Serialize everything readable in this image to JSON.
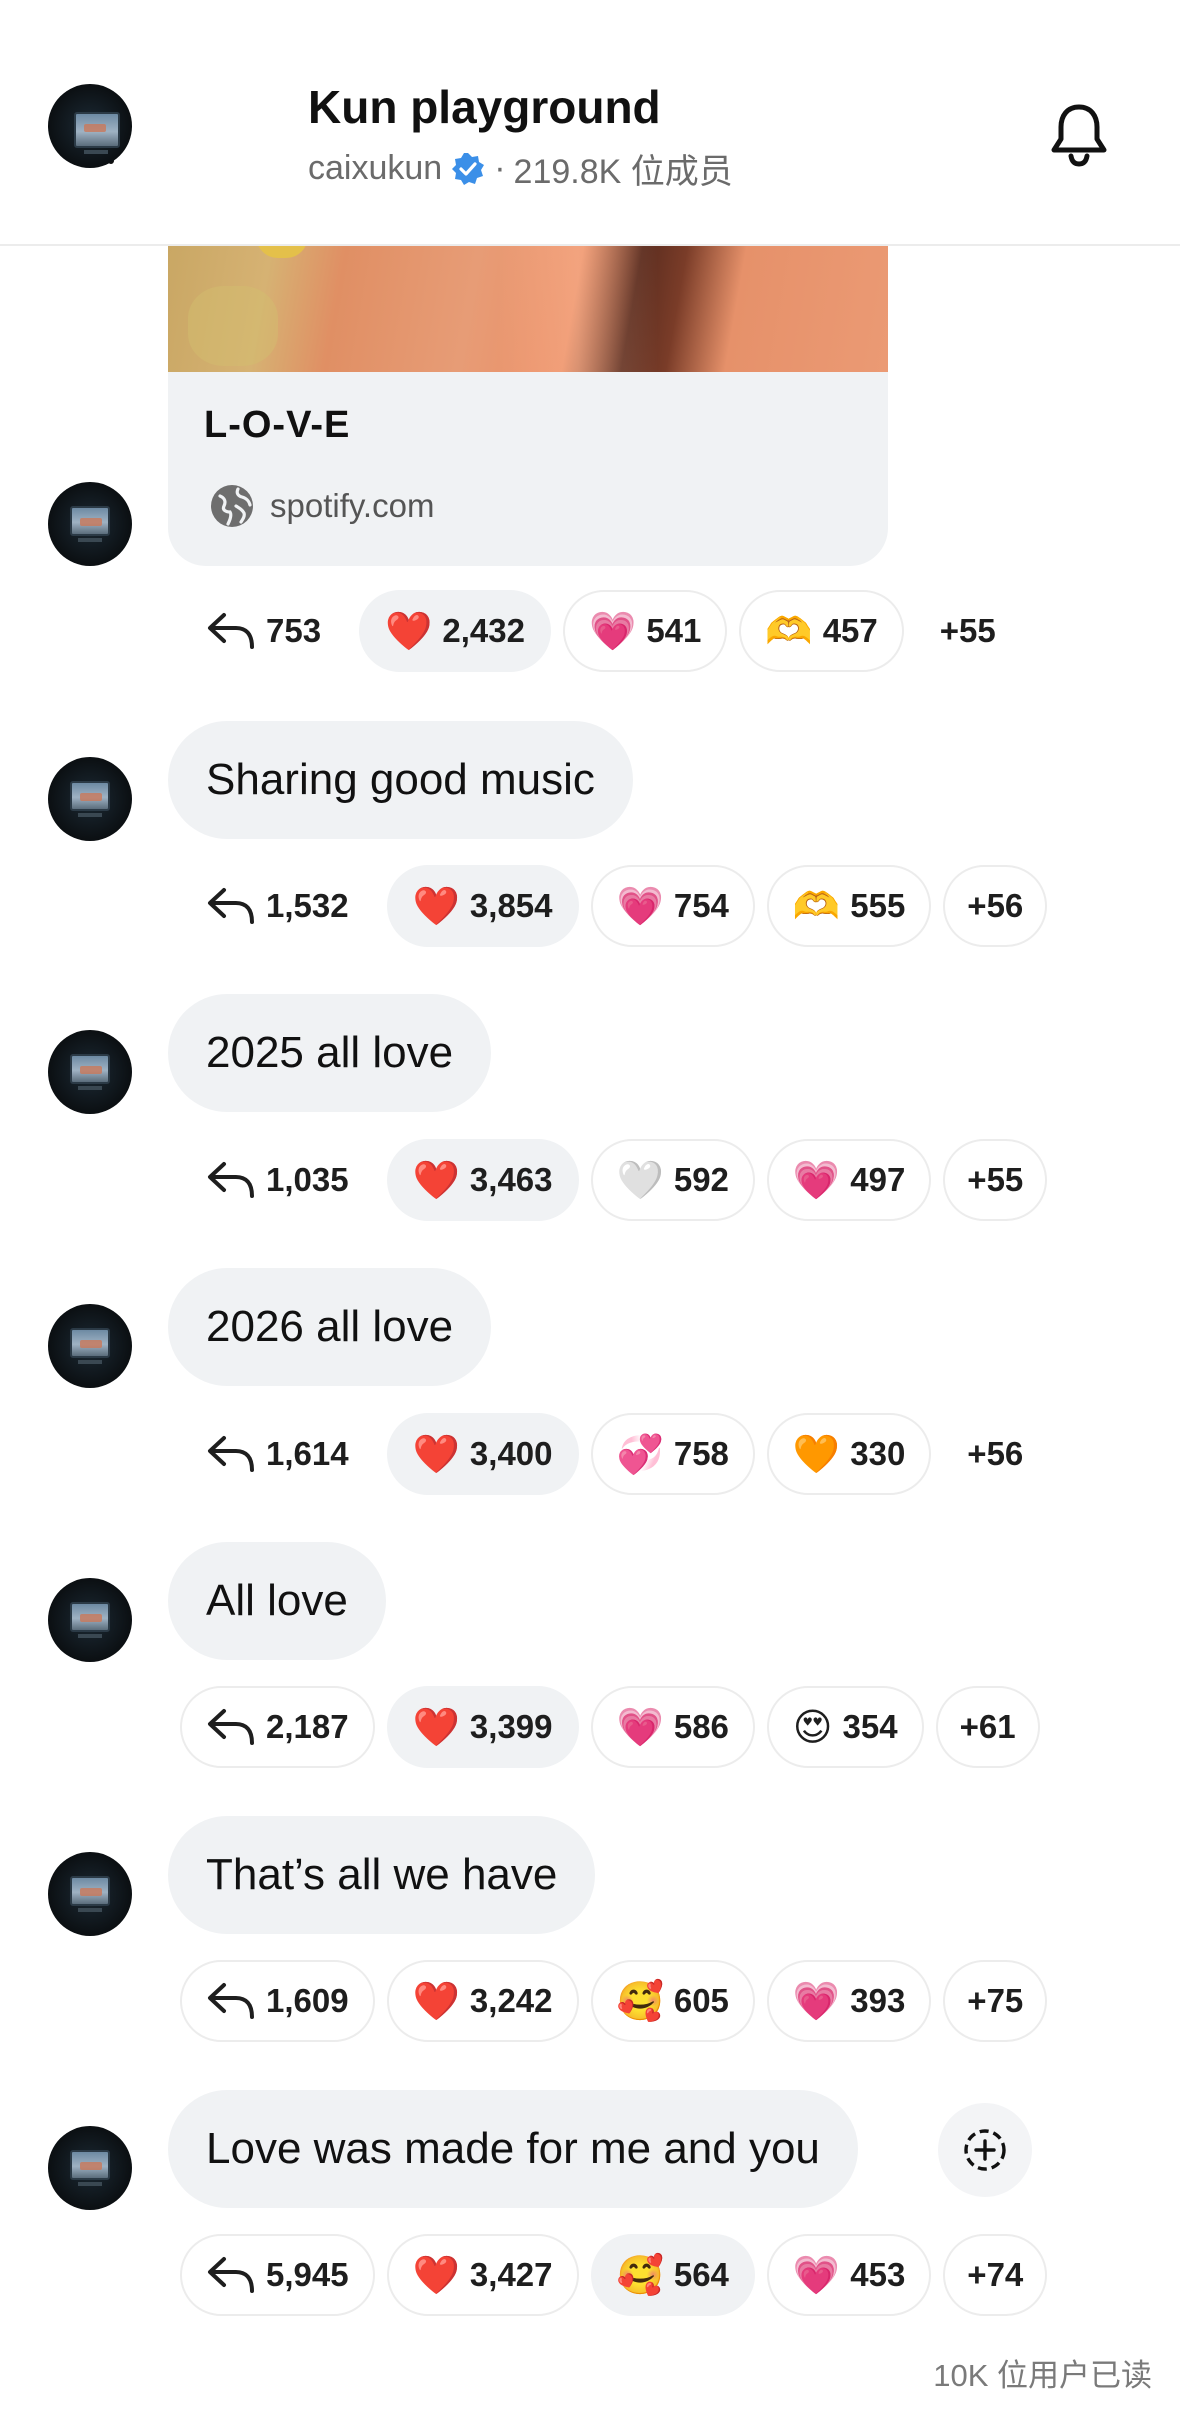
{
  "header": {
    "title": "Kun playground",
    "creator": "caixukun",
    "separator": "·",
    "members": "219.8K 位成员"
  },
  "link_card": {
    "title": "L-O-V-E",
    "domain": "spotify.com"
  },
  "first_reactions": {
    "replies": "753",
    "items": [
      {
        "emoji": "❤️",
        "count": "2,432",
        "style": "filled"
      },
      {
        "emoji": "💗",
        "count": "541",
        "style": "outline"
      },
      {
        "emoji": "🫶",
        "count": "457",
        "style": "outline"
      }
    ],
    "more": "+55"
  },
  "messages": [
    {
      "text": "Sharing good music",
      "replies": "1,532",
      "reactions": [
        {
          "emoji": "❤️",
          "count": "3,854",
          "style": "filled"
        },
        {
          "emoji": "💗",
          "count": "754",
          "style": "outline"
        },
        {
          "emoji": "🫶",
          "count": "555",
          "style": "outline"
        }
      ],
      "more": "+56"
    },
    {
      "text": "2025 all love",
      "replies": "1,035",
      "reactions": [
        {
          "emoji": "❤️",
          "count": "3,463",
          "style": "filled"
        },
        {
          "emoji": "🤍",
          "count": "592",
          "style": "outline"
        },
        {
          "emoji": "💗",
          "count": "497",
          "style": "outline"
        }
      ],
      "more": "+55"
    },
    {
      "text": "2026 all love",
      "replies": "1,614",
      "reactions": [
        {
          "emoji": "❤️",
          "count": "3,400",
          "style": "filled"
        },
        {
          "emoji": "💞",
          "count": "758",
          "style": "outline"
        },
        {
          "emoji": "🧡",
          "count": "330",
          "style": "outline"
        }
      ],
      "more": "+56"
    },
    {
      "text": "All love",
      "replies": "2,187",
      "reactions": [
        {
          "emoji": "❤️",
          "count": "3,399",
          "style": "filled"
        },
        {
          "emoji": "💗",
          "count": "586",
          "style": "outline"
        },
        {
          "emoji": "😍",
          "count": "354",
          "style": "outline"
        }
      ],
      "more": "+61"
    },
    {
      "text": "That’s all we have",
      "replies": "1,609",
      "reactions": [
        {
          "emoji": "❤️",
          "count": "3,242",
          "style": "outline"
        },
        {
          "emoji": "🥰",
          "count": "605",
          "style": "outline"
        },
        {
          "emoji": "💗",
          "count": "393",
          "style": "outline"
        }
      ],
      "more": "+75"
    },
    {
      "text": "Love was made for me and you",
      "replies": "5,945",
      "reactions": [
        {
          "emoji": "❤️",
          "count": "3,427",
          "style": "outline"
        },
        {
          "emoji": "🥰",
          "count": "564",
          "style": "filled"
        },
        {
          "emoji": "💗",
          "count": "453",
          "style": "outline"
        }
      ],
      "more": "+74"
    }
  ],
  "footer": {
    "read_count": "10K 位用户已读"
  },
  "icons": {
    "back": "chevron-left-icon",
    "bell": "bell-icon",
    "verified": "verified-badge-icon",
    "globe": "globe-icon",
    "reply": "reply-arrow-icon",
    "add_reaction": "add-reaction-icon"
  },
  "colors": {
    "bubble_bg": "#f0f2f4",
    "verified": "#3b8fe8",
    "text": "#111111",
    "muted": "#6b6b6b"
  }
}
